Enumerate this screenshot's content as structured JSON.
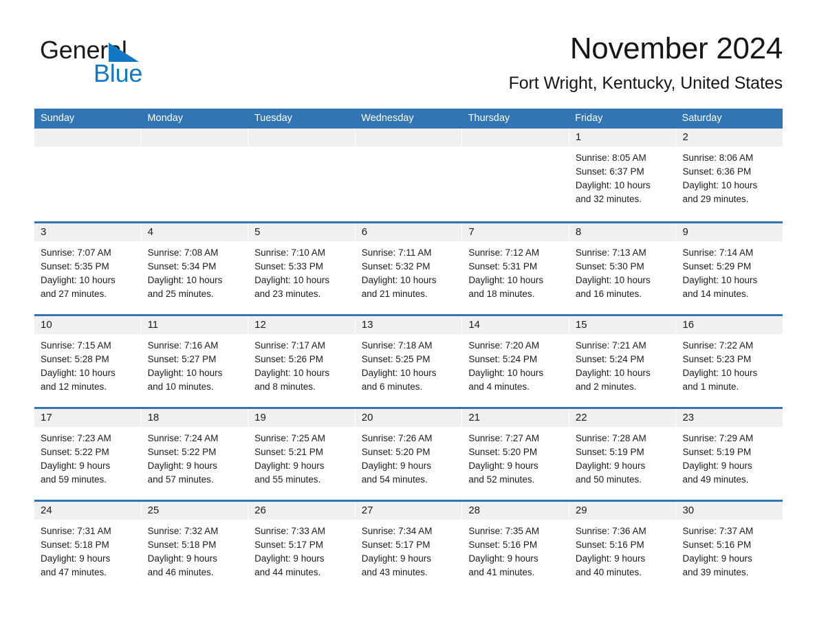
{
  "brand": {
    "name_part1": "General",
    "name_part2": "Blue",
    "accent_color": "#1277c4",
    "header_blue": "#3175b4"
  },
  "header": {
    "month_title": "November 2024",
    "location": "Fort Wright, Kentucky, United States"
  },
  "calendar": {
    "weekday_headers": [
      "Sunday",
      "Monday",
      "Tuesday",
      "Wednesday",
      "Thursday",
      "Friday",
      "Saturday"
    ],
    "weeks": [
      [
        {
          "date": "",
          "empty": true
        },
        {
          "date": "",
          "empty": true
        },
        {
          "date": "",
          "empty": true
        },
        {
          "date": "",
          "empty": true
        },
        {
          "date": "",
          "empty": true
        },
        {
          "date": "1",
          "sunrise": "Sunrise: 8:05 AM",
          "sunset": "Sunset: 6:37 PM",
          "daylight_l1": "Daylight: 10 hours",
          "daylight_l2": "and 32 minutes."
        },
        {
          "date": "2",
          "sunrise": "Sunrise: 8:06 AM",
          "sunset": "Sunset: 6:36 PM",
          "daylight_l1": "Daylight: 10 hours",
          "daylight_l2": "and 29 minutes."
        }
      ],
      [
        {
          "date": "3",
          "sunrise": "Sunrise: 7:07 AM",
          "sunset": "Sunset: 5:35 PM",
          "daylight_l1": "Daylight: 10 hours",
          "daylight_l2": "and 27 minutes."
        },
        {
          "date": "4",
          "sunrise": "Sunrise: 7:08 AM",
          "sunset": "Sunset: 5:34 PM",
          "daylight_l1": "Daylight: 10 hours",
          "daylight_l2": "and 25 minutes."
        },
        {
          "date": "5",
          "sunrise": "Sunrise: 7:10 AM",
          "sunset": "Sunset: 5:33 PM",
          "daylight_l1": "Daylight: 10 hours",
          "daylight_l2": "and 23 minutes."
        },
        {
          "date": "6",
          "sunrise": "Sunrise: 7:11 AM",
          "sunset": "Sunset: 5:32 PM",
          "daylight_l1": "Daylight: 10 hours",
          "daylight_l2": "and 21 minutes."
        },
        {
          "date": "7",
          "sunrise": "Sunrise: 7:12 AM",
          "sunset": "Sunset: 5:31 PM",
          "daylight_l1": "Daylight: 10 hours",
          "daylight_l2": "and 18 minutes."
        },
        {
          "date": "8",
          "sunrise": "Sunrise: 7:13 AM",
          "sunset": "Sunset: 5:30 PM",
          "daylight_l1": "Daylight: 10 hours",
          "daylight_l2": "and 16 minutes."
        },
        {
          "date": "9",
          "sunrise": "Sunrise: 7:14 AM",
          "sunset": "Sunset: 5:29 PM",
          "daylight_l1": "Daylight: 10 hours",
          "daylight_l2": "and 14 minutes."
        }
      ],
      [
        {
          "date": "10",
          "sunrise": "Sunrise: 7:15 AM",
          "sunset": "Sunset: 5:28 PM",
          "daylight_l1": "Daylight: 10 hours",
          "daylight_l2": "and 12 minutes."
        },
        {
          "date": "11",
          "sunrise": "Sunrise: 7:16 AM",
          "sunset": "Sunset: 5:27 PM",
          "daylight_l1": "Daylight: 10 hours",
          "daylight_l2": "and 10 minutes."
        },
        {
          "date": "12",
          "sunrise": "Sunrise: 7:17 AM",
          "sunset": "Sunset: 5:26 PM",
          "daylight_l1": "Daylight: 10 hours",
          "daylight_l2": "and 8 minutes."
        },
        {
          "date": "13",
          "sunrise": "Sunrise: 7:18 AM",
          "sunset": "Sunset: 5:25 PM",
          "daylight_l1": "Daylight: 10 hours",
          "daylight_l2": "and 6 minutes."
        },
        {
          "date": "14",
          "sunrise": "Sunrise: 7:20 AM",
          "sunset": "Sunset: 5:24 PM",
          "daylight_l1": "Daylight: 10 hours",
          "daylight_l2": "and 4 minutes."
        },
        {
          "date": "15",
          "sunrise": "Sunrise: 7:21 AM",
          "sunset": "Sunset: 5:24 PM",
          "daylight_l1": "Daylight: 10 hours",
          "daylight_l2": "and 2 minutes."
        },
        {
          "date": "16",
          "sunrise": "Sunrise: 7:22 AM",
          "sunset": "Sunset: 5:23 PM",
          "daylight_l1": "Daylight: 10 hours",
          "daylight_l2": "and 1 minute."
        }
      ],
      [
        {
          "date": "17",
          "sunrise": "Sunrise: 7:23 AM",
          "sunset": "Sunset: 5:22 PM",
          "daylight_l1": "Daylight: 9 hours",
          "daylight_l2": "and 59 minutes."
        },
        {
          "date": "18",
          "sunrise": "Sunrise: 7:24 AM",
          "sunset": "Sunset: 5:22 PM",
          "daylight_l1": "Daylight: 9 hours",
          "daylight_l2": "and 57 minutes."
        },
        {
          "date": "19",
          "sunrise": "Sunrise: 7:25 AM",
          "sunset": "Sunset: 5:21 PM",
          "daylight_l1": "Daylight: 9 hours",
          "daylight_l2": "and 55 minutes."
        },
        {
          "date": "20",
          "sunrise": "Sunrise: 7:26 AM",
          "sunset": "Sunset: 5:20 PM",
          "daylight_l1": "Daylight: 9 hours",
          "daylight_l2": "and 54 minutes."
        },
        {
          "date": "21",
          "sunrise": "Sunrise: 7:27 AM",
          "sunset": "Sunset: 5:20 PM",
          "daylight_l1": "Daylight: 9 hours",
          "daylight_l2": "and 52 minutes."
        },
        {
          "date": "22",
          "sunrise": "Sunrise: 7:28 AM",
          "sunset": "Sunset: 5:19 PM",
          "daylight_l1": "Daylight: 9 hours",
          "daylight_l2": "and 50 minutes."
        },
        {
          "date": "23",
          "sunrise": "Sunrise: 7:29 AM",
          "sunset": "Sunset: 5:19 PM",
          "daylight_l1": "Daylight: 9 hours",
          "daylight_l2": "and 49 minutes."
        }
      ],
      [
        {
          "date": "24",
          "sunrise": "Sunrise: 7:31 AM",
          "sunset": "Sunset: 5:18 PM",
          "daylight_l1": "Daylight: 9 hours",
          "daylight_l2": "and 47 minutes."
        },
        {
          "date": "25",
          "sunrise": "Sunrise: 7:32 AM",
          "sunset": "Sunset: 5:18 PM",
          "daylight_l1": "Daylight: 9 hours",
          "daylight_l2": "and 46 minutes."
        },
        {
          "date": "26",
          "sunrise": "Sunrise: 7:33 AM",
          "sunset": "Sunset: 5:17 PM",
          "daylight_l1": "Daylight: 9 hours",
          "daylight_l2": "and 44 minutes."
        },
        {
          "date": "27",
          "sunrise": "Sunrise: 7:34 AM",
          "sunset": "Sunset: 5:17 PM",
          "daylight_l1": "Daylight: 9 hours",
          "daylight_l2": "and 43 minutes."
        },
        {
          "date": "28",
          "sunrise": "Sunrise: 7:35 AM",
          "sunset": "Sunset: 5:16 PM",
          "daylight_l1": "Daylight: 9 hours",
          "daylight_l2": "and 41 minutes."
        },
        {
          "date": "29",
          "sunrise": "Sunrise: 7:36 AM",
          "sunset": "Sunset: 5:16 PM",
          "daylight_l1": "Daylight: 9 hours",
          "daylight_l2": "and 40 minutes."
        },
        {
          "date": "30",
          "sunrise": "Sunrise: 7:37 AM",
          "sunset": "Sunset: 5:16 PM",
          "daylight_l1": "Daylight: 9 hours",
          "daylight_l2": "and 39 minutes."
        }
      ]
    ]
  }
}
